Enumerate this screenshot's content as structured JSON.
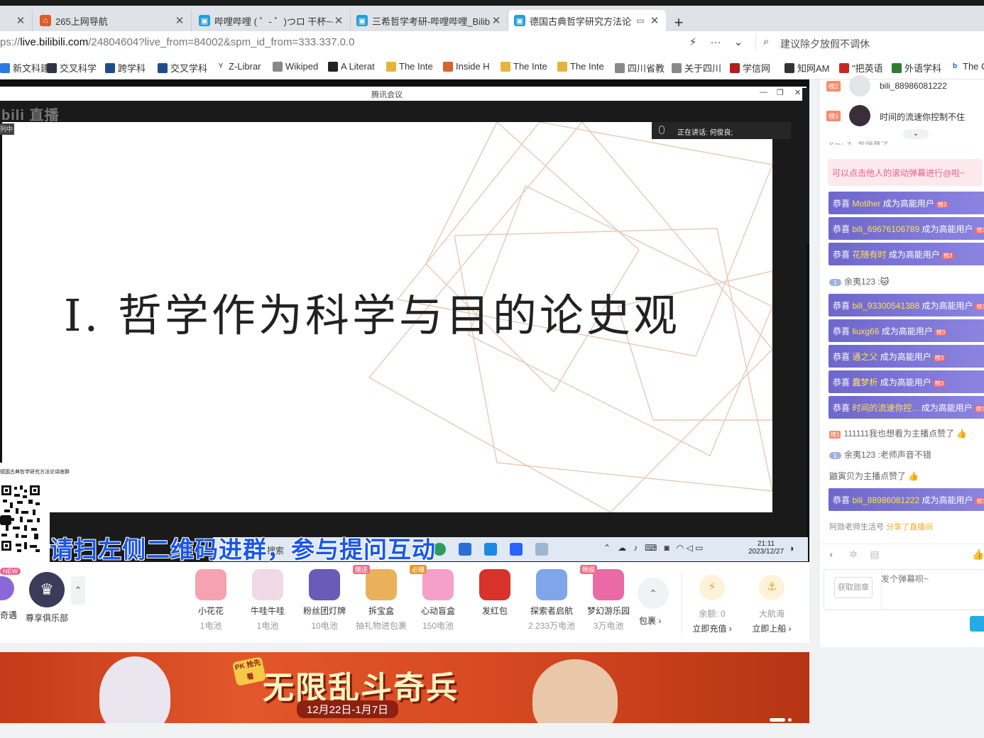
{
  "tabs": [
    {
      "title": "",
      "active": false
    },
    {
      "title": "265上网导航",
      "active": false
    },
    {
      "title": "哔哩哔哩 ( ゜- ゜)つロ 干杯~-bi",
      "active": false
    },
    {
      "title": "三希哲学考研-哔哩哔哩_Bilibili",
      "active": false
    },
    {
      "title": "德国古典哲学研究方法论讲",
      "active": true
    }
  ],
  "address": {
    "prefix": "ps://",
    "host": "live.bilibili.com",
    "path": "/24804604?live_from=84002&spm_id_from=333.337.0.0",
    "search_placeholder": "建议除夕放假不调休"
  },
  "bookmarks": [
    "新文科建",
    "交叉科学",
    "跨学科",
    "交叉学科",
    "Z-Librar",
    "Wikiped",
    "A Literat",
    "The Inte",
    "Inside H",
    "The Inte",
    "The Inte",
    "四川省教",
    "关于四川",
    "学信网",
    "知网AM",
    "\"把英语",
    "外语学科",
    "The C"
  ],
  "meeting": {
    "window_title": "腾讯会议",
    "speaking_label": "正在讲话:",
    "speaker": "何俊良;",
    "live_tag": "列中",
    "logo": "bili 直播"
  },
  "slide": {
    "heading": "Ⅰ. 哲学作为科学与目的论史观"
  },
  "overlay": {
    "qr_caption": "德国古典哲学研究方法论讲座群",
    "banner": "请扫左侧二维码进群，参与提问互动",
    "taskbar_search": "搜索",
    "clock_time": "21:11",
    "clock_date": "2023/12/27"
  },
  "gift_bar": {
    "qiyu_label": "奇遇",
    "new_badge": "NEW",
    "club_label": "尊享俱乐部",
    "gifts": [
      {
        "name": "小花花",
        "price": "1电池",
        "tag": "",
        "color": "#f5a3b0"
      },
      {
        "name": "牛哇牛哇",
        "price": "1电池",
        "tag": "",
        "color": "#f0d9e6"
      },
      {
        "name": "粉丝团灯牌",
        "price": "10电池",
        "tag": "",
        "color": "#6b5bb8"
      },
      {
        "name": "拆宝盒",
        "price": "抽礼物进包裹",
        "tag": "赠送",
        "color": "#e9b25a"
      },
      {
        "name": "心动盲盒",
        "price": "150电池",
        "tag": "必赚",
        "color": "#f4a0c8"
      },
      {
        "name": "发红包",
        "price": "",
        "tag": "",
        "color": "#d8322c"
      },
      {
        "name": "探索者启航",
        "price": "2.233万电池",
        "tag": "",
        "color": "#7fa6e8"
      },
      {
        "name": "梦幻游乐园",
        "price": "3万电池",
        "tag": "畅娱",
        "color": "#e96aa5"
      }
    ],
    "pack_label": "包裹",
    "balance_label": "余额: 0",
    "recharge_label": "立即充值",
    "captain_label": "大航海",
    "board_label": "立即上船"
  },
  "ad": {
    "badge": "PK 抢先看",
    "title": "无限乱斗奇兵",
    "date": "12月22日-1月7日"
  },
  "chat": {
    "ranks": [
      {
        "badge": "榜2",
        "name": "bili_88986081222"
      },
      {
        "badge": "榜3",
        "name": "时间的流速你控制不住"
      }
    ],
    "cut_text": "Kay_T...发弹幕了",
    "tip": "可以点击他人的滚动弹幕进行@啦~",
    "congrats_prefix": "恭喜",
    "congrats_suffix": "成为高能用户",
    "medal": "榜3",
    "congrats_users": [
      "Motiher",
      "bili_69676106789",
      "花随有时",
      "bili_93300541388",
      "liuxg66",
      "通之父",
      "蠢梦析",
      "时间的流速你控...",
      "bili_88986081222"
    ],
    "msg1_level": "1",
    "msg1_user": "余夷123 :",
    "msg1_emoji": "🐱",
    "msg2_rank": "榜1",
    "msg2_text": "111111我也想看为主播点赞了",
    "msg3_level": "1",
    "msg3_user": "余夷123 :",
    "msg3_text": "老师声音不错",
    "msg4_text": "鼬寅贝为主播点赞了",
    "share_user": "阿勋老师生活号",
    "share_text": "分享了直播间",
    "medal_btn": "获取勋章",
    "input_placeholder": "发个弹幕呗~"
  }
}
